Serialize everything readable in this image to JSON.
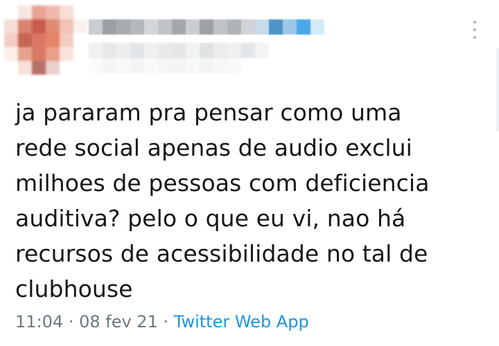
{
  "author": {
    "avatar_icon": "user-avatar-icon",
    "display_name": "",
    "handle": ""
  },
  "menu": {
    "more_icon": "more-vertical-icon"
  },
  "tweet": {
    "text": "ja pararam pra pensar como uma\nrede social apenas de audio exclui\nmilhoes de pessoas com deficiencia\nauditiva? pelo o que eu vi, nao há\nrecursos de acessibilidade no tal de\nclubhouse",
    "time": "11:04",
    "separator": "·",
    "date": "08 fev 21",
    "source": "Twitter Web App"
  },
  "colors": {
    "text": "#141619",
    "meta": "#697882",
    "link": "#1b95e0"
  }
}
